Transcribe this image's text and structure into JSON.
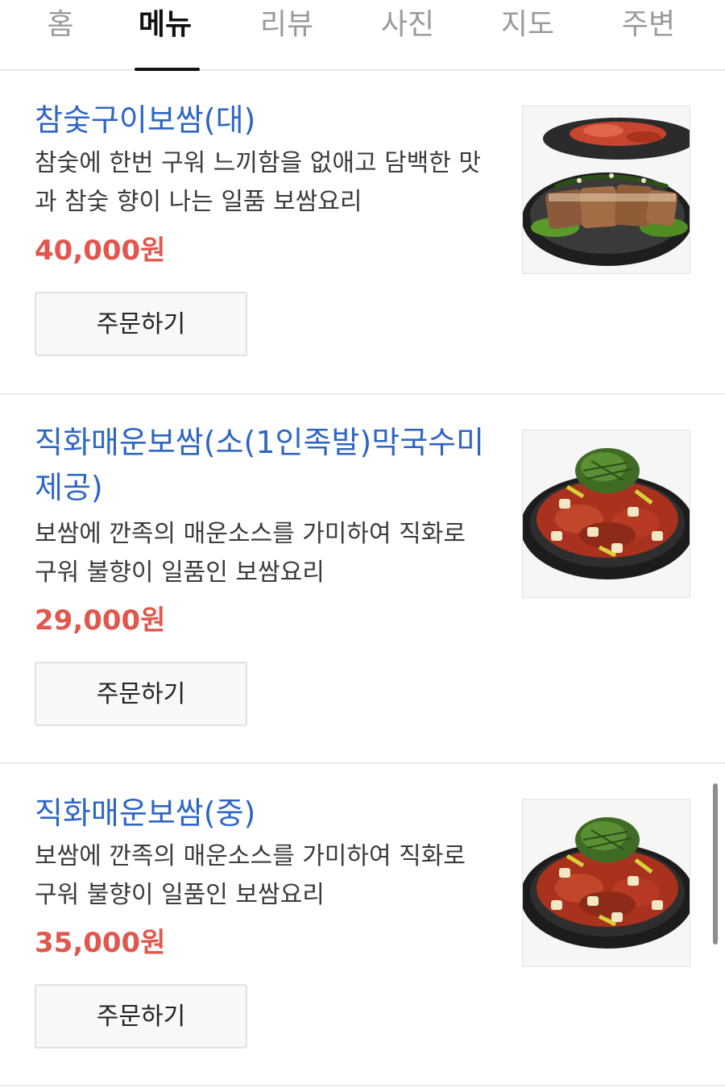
{
  "tabs": [
    {
      "label": "홈",
      "active": false
    },
    {
      "label": "메뉴",
      "active": true
    },
    {
      "label": "리뷰",
      "active": false
    },
    {
      "label": "사진",
      "active": false
    },
    {
      "label": "지도",
      "active": false
    },
    {
      "label": "주변",
      "active": false
    }
  ],
  "menu_items": [
    {
      "title": "참숯구이보쌈(대)",
      "description": "참숯에 한번 구워 느끼함을 없애고 담백한 맛과 참숯 향이 나는 일품 보쌈요리",
      "price": "40,000원",
      "order_label": "주문하기"
    },
    {
      "title": "직화매운보쌈(소(1인족발)막국수미제공)",
      "description": "보쌈에 깐족의 매운소스를 가미하여 직화로 구워 불향이 일품인 보쌈요리",
      "price": "29,000원",
      "order_label": "주문하기"
    },
    {
      "title": "직화매운보쌈(중)",
      "description": "보쌈에 깐족의 매운소스를 가미하여 직화로 구워 불향이 일품인 보쌈요리",
      "price": "35,000원",
      "order_label": "주문하기"
    }
  ],
  "colors": {
    "title": "#2f66c4",
    "price": "#e0574e",
    "active_tab": "#111111",
    "inactive_tab": "#9a9a9a"
  }
}
